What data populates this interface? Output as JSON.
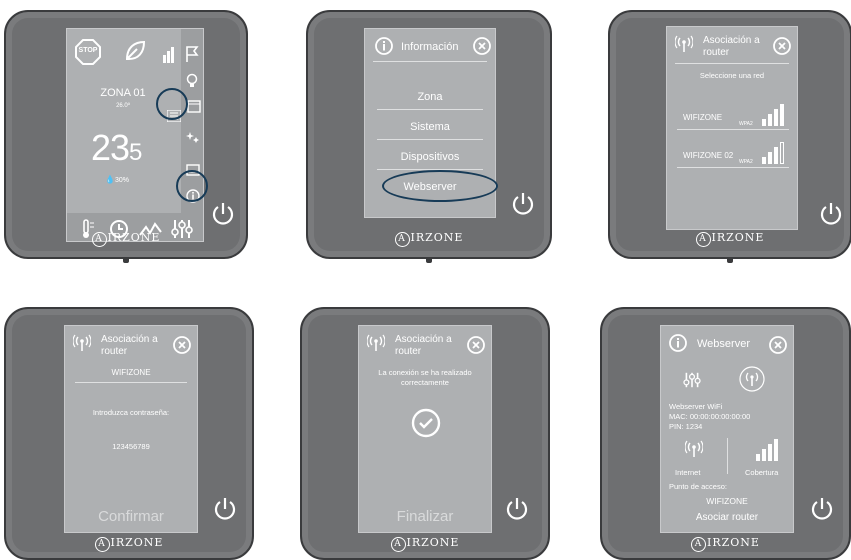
{
  "brand": "IRZONE",
  "brand_mark": "A",
  "panel1": {
    "stop_label": "STOP",
    "zone_name": "ZONA 01",
    "setpoint": "26.0º",
    "temperature_int": "23",
    "temperature_dec": "5",
    "humidity": "30%"
  },
  "panel2": {
    "title": "Información",
    "menu": [
      "Zona",
      "Sistema",
      "Dispositivos",
      "Webserver"
    ]
  },
  "panel3": {
    "title_line1": "Asociación a",
    "title_line2": "router",
    "instruction": "Seleccione una red",
    "networks": [
      {
        "ssid": "WIFIZONE",
        "security": "WPA2",
        "signal_bars": 4
      },
      {
        "ssid": "WIFIZONE 02",
        "security": "WPA2",
        "signal_bars": 3
      }
    ]
  },
  "panel4": {
    "title_line1": "Asociación a",
    "title_line2": "router",
    "ssid": "WIFIZONE",
    "prompt": "Introduzca contraseña:",
    "password": "123456789",
    "confirm": "Confirmar"
  },
  "panel5": {
    "title_line1": "Asociación a",
    "title_line2": "router",
    "message_line1": "La conexión se ha realizado",
    "message_line2": "correctamente",
    "finish": "Finalizar"
  },
  "panel6": {
    "title": "Webserver",
    "device_name": "Webserver WiFi",
    "mac": "MAC: 00:00:00:00:00:00",
    "pin": "PIN: 1234",
    "internet": "Internet",
    "coverage": "Cobertura",
    "access_point_label": "Punto de acceso:",
    "access_point": "WIFIZONE",
    "associate": "Asociar router"
  },
  "colors": {
    "bezel": "#6e6f71",
    "screen": "#aeb0b2",
    "highlight": "#173b57"
  }
}
